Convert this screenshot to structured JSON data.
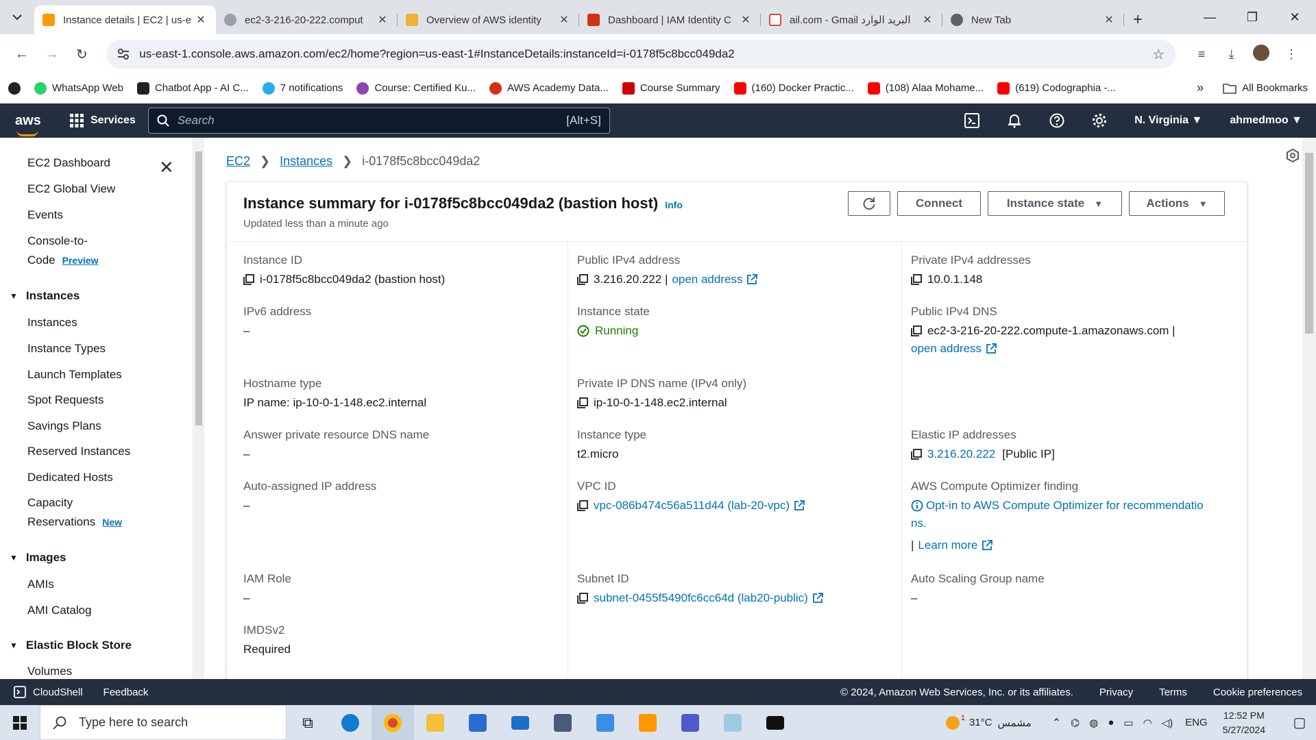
{
  "browser": {
    "tabs": [
      {
        "title": "Instance details | EC2 | us-e",
        "active": true,
        "favicon_color": "#ff9900"
      },
      {
        "title": "ec2-3-216-20-222.comput",
        "active": false,
        "favicon_color": "#9aa0a6"
      },
      {
        "title": "Overview of AWS identity",
        "active": false,
        "favicon_color": "#f2b134"
      },
      {
        "title": "Dashboard | IAM Identity C",
        "active": false,
        "favicon_color": "#d13212"
      },
      {
        "title": "ail.com - Gmail البريد الوارد",
        "active": false,
        "favicon_color": "#ea4335"
      },
      {
        "title": "New Tab",
        "active": false,
        "favicon_color": "#5f6368"
      }
    ],
    "url": "us-east-1.console.aws.amazon.com/ec2/home?region=us-east-1#InstanceDetails:instanceId=i-0178f5c8bcc049da2",
    "bookmarks": [
      {
        "label": "",
        "color": "#222"
      },
      {
        "label": "WhatsApp Web",
        "color": "#25d366"
      },
      {
        "label": "Chatbot App - AI C...",
        "color": "#222"
      },
      {
        "label": "7 notifications",
        "color": "#2aabee"
      },
      {
        "label": "Course: Certified Ku...",
        "color": "#8e44ad"
      },
      {
        "label": "AWS Academy Data...",
        "color": "#d13212"
      },
      {
        "label": "Course Summary",
        "color": "#cc0000"
      },
      {
        "label": "(160) Docker Practic...",
        "color": "#ff0000"
      },
      {
        "label": "(108) Alaa Mohame...",
        "color": "#ff0000"
      },
      {
        "label": "(619) Codographia -...",
        "color": "#ff0000"
      }
    ],
    "bookmarks_more": "»",
    "all_bookmarks": "All Bookmarks"
  },
  "aws_nav": {
    "logo": "aws",
    "services": "Services",
    "search_placeholder": "Search",
    "search_shortcut": "[Alt+S]",
    "region": "N. Virginia",
    "user": "ahmedmoo"
  },
  "sidebar": {
    "top_items": [
      "EC2 Dashboard",
      "EC2 Global View",
      "Events",
      "Console-to-",
      "Code"
    ],
    "preview_badge": "Preview",
    "instances_section": "Instances",
    "instances_items": [
      "Instances",
      "Instance Types",
      "Launch Templates",
      "Spot Requests",
      "Savings Plans",
      "Reserved Instances",
      "Dedicated Hosts",
      "Capacity",
      "Reservations"
    ],
    "new_badge": "New",
    "images_section": "Images",
    "images_items": [
      "AMIs",
      "AMI Catalog"
    ],
    "ebs_section": "Elastic Block Store",
    "ebs_items": [
      "Volumes"
    ]
  },
  "breadcrumb": {
    "ec2": "EC2",
    "instances": "Instances",
    "current": "i-0178f5c8bcc049da2"
  },
  "summary": {
    "title": "Instance summary for i-0178f5c8bcc049da2 (bastion host)",
    "info": "Info",
    "updated": "Updated less than a minute ago",
    "buttons": {
      "connect": "Connect",
      "instance_state": "Instance state",
      "actions": "Actions"
    }
  },
  "fields": {
    "instance_id": {
      "label": "Instance ID",
      "value": "i-0178f5c8bcc049da2 (bastion host)"
    },
    "public_ipv4": {
      "label": "Public IPv4 address",
      "value": "3.216.20.222 |",
      "link": "open address"
    },
    "private_ipv4": {
      "label": "Private IPv4 addresses",
      "value": "10.0.1.148"
    },
    "ipv6": {
      "label": "IPv6 address",
      "value": "–"
    },
    "instance_state": {
      "label": "Instance state",
      "value": "Running"
    },
    "public_dns": {
      "label": "Public IPv4 DNS",
      "value": "ec2-3-216-20-222.compute-1.amazonaws.com |",
      "link": "open address"
    },
    "hostname_type": {
      "label": "Hostname type",
      "value": "IP name: ip-10-0-1-148.ec2.internal"
    },
    "private_dns": {
      "label": "Private IP DNS name (IPv4 only)",
      "value": "ip-10-0-1-148.ec2.internal"
    },
    "answer_dns": {
      "label": "Answer private resource DNS name",
      "value": "–"
    },
    "instance_type": {
      "label": "Instance type",
      "value": "t2.micro"
    },
    "elastic_ip": {
      "label": "Elastic IP addresses",
      "value": "3.216.20.222",
      "suffix": "[Public IP]"
    },
    "auto_ip": {
      "label": "Auto-assigned IP address",
      "value": "–"
    },
    "vpc_id": {
      "label": "VPC ID",
      "value": "vpc-086b474c56a511d44 (lab-20-vpc)"
    },
    "optimizer": {
      "label": "AWS Compute Optimizer finding",
      "line1": "Opt-in to AWS Compute Optimizer for recommendatio",
      "line2": "ns.",
      "learn_prefix": "|",
      "learn_more": "Learn more"
    },
    "iam_role": {
      "label": "IAM Role",
      "value": "–"
    },
    "subnet_id": {
      "label": "Subnet ID",
      "value": "subnet-0455f5490fc6cc64d (lab20-public)"
    },
    "asg_name": {
      "label": "Auto Scaling Group name",
      "value": "–"
    },
    "imdsv2": {
      "label": "IMDSv2",
      "value": "Required"
    }
  },
  "footer": {
    "cloudshell": "CloudShell",
    "feedback": "Feedback",
    "copyright": "© 2024, Amazon Web Services, Inc. or its affiliates.",
    "privacy": "Privacy",
    "terms": "Terms",
    "cookies": "Cookie preferences"
  },
  "taskbar": {
    "search_placeholder": "Type here to search",
    "weather": "31°C",
    "weather_text": "مشمس",
    "weather_alert": "1",
    "lang": "ENG",
    "time": "12:52 PM",
    "date": "5/27/2024"
  },
  "colors": {
    "aws_dark": "#232f3e",
    "aws_orange": "#ff9900",
    "link_blue": "#0073bb",
    "running_green": "#1d8102"
  }
}
